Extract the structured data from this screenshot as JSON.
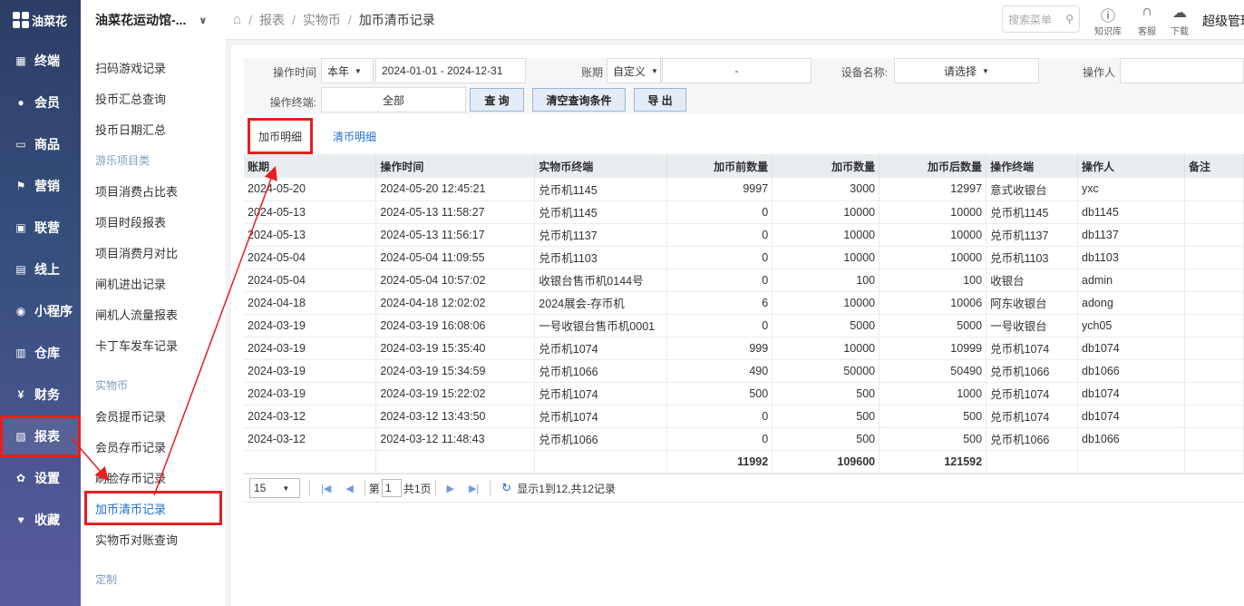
{
  "brand": {
    "name": "油菜花"
  },
  "nav": [
    {
      "label": "终端",
      "icon": "terminal-icon",
      "glyph": "▦"
    },
    {
      "label": "会员",
      "icon": "member-icon",
      "glyph": "●"
    },
    {
      "label": "商品",
      "icon": "goods-icon",
      "glyph": "▭"
    },
    {
      "label": "营销",
      "icon": "flag-icon",
      "glyph": "⚑"
    },
    {
      "label": "联营",
      "icon": "gift-icon",
      "glyph": "▣"
    },
    {
      "label": "线上",
      "icon": "calendar-icon",
      "glyph": "▤"
    },
    {
      "label": "小程序",
      "icon": "mini-program-icon",
      "glyph": "◉"
    },
    {
      "label": "仓库",
      "icon": "warehouse-icon",
      "glyph": "▥"
    },
    {
      "label": "财务",
      "icon": "finance-icon",
      "glyph": "¥"
    },
    {
      "label": "报表",
      "icon": "report-icon",
      "glyph": "▧"
    },
    {
      "label": "设置",
      "icon": "gear-icon",
      "glyph": "✿"
    },
    {
      "label": "收藏",
      "icon": "heart-icon",
      "glyph": "♥"
    }
  ],
  "shop": {
    "name": "油菜花运动馆-..."
  },
  "submenu": {
    "items_top": [
      "扫码游戏记录",
      "投币汇总查询",
      "投币日期汇总"
    ],
    "group1": "游乐项目类",
    "items_mid": [
      "项目消费占比表",
      "项目时段报表",
      "项目消费月对比",
      "闸机进出记录",
      "闸机人流量报表",
      "卡丁车发车记录"
    ],
    "group2": "实物币",
    "items_bottom": [
      "会员提币记录",
      "会员存币记录",
      "刷脸存币记录",
      "加币清币记录",
      "实物币对账查询"
    ],
    "group3": "定制"
  },
  "breadcrumb": [
    "报表",
    "实物币",
    "加币清币记录"
  ],
  "header": {
    "search_placeholder": "搜索菜单",
    "help_label": "知识库",
    "service_label": "客服",
    "download_label": "下载",
    "user": "超级管理"
  },
  "filters": {
    "op_time_label": "操作时间",
    "op_time_mode": "本年",
    "op_time_range": "2024-01-01 - 2024-12-31",
    "period_label": "账期",
    "period_mode": "自定义",
    "period_range": "-",
    "device_label": "设备名称:",
    "device_value": "请选择",
    "operator_label": "操作人",
    "operator_value": "",
    "terminal_label": "操作终端:",
    "terminal_value": "全部",
    "query_btn": "查 询",
    "clear_btn": "清空查询条件",
    "export_btn": "导 出"
  },
  "tabs": [
    "加币明细",
    "清币明细"
  ],
  "table": {
    "headers": [
      "账期",
      "操作时间",
      "实物币终端",
      "加币前数量",
      "加币数量",
      "加币后数量",
      "操作终端",
      "操作人",
      "备注"
    ],
    "rows": [
      [
        "2024-05-20",
        "2024-05-20 12:45:21",
        "兑币机1145",
        "9997",
        "3000",
        "12997",
        "意式收银台",
        "yxc",
        ""
      ],
      [
        "2024-05-13",
        "2024-05-13 11:58:27",
        "兑币机1145",
        "0",
        "10000",
        "10000",
        "兑币机1145",
        "db1145",
        ""
      ],
      [
        "2024-05-13",
        "2024-05-13 11:56:17",
        "兑币机1137",
        "0",
        "10000",
        "10000",
        "兑币机1137",
        "db1137",
        ""
      ],
      [
        "2024-05-04",
        "2024-05-04 11:09:55",
        "兑币机1103",
        "0",
        "10000",
        "10000",
        "兑币机1103",
        "db1103",
        ""
      ],
      [
        "2024-05-04",
        "2024-05-04 10:57:02",
        "收银台售币机0144号",
        "0",
        "100",
        "100",
        "收银台",
        "admin",
        ""
      ],
      [
        "2024-04-18",
        "2024-04-18 12:02:02",
        "2024展会-存币机",
        "6",
        "10000",
        "10006",
        "阿东收银台",
        "adong",
        ""
      ],
      [
        "2024-03-19",
        "2024-03-19 16:08:06",
        "一号收银台售币机0001",
        "0",
        "5000",
        "5000",
        "一号收银台",
        "ych05",
        ""
      ],
      [
        "2024-03-19",
        "2024-03-19 15:35:40",
        "兑币机1074",
        "999",
        "10000",
        "10999",
        "兑币机1074",
        "db1074",
        ""
      ],
      [
        "2024-03-19",
        "2024-03-19 15:34:59",
        "兑币机1066",
        "490",
        "50000",
        "50490",
        "兑币机1066",
        "db1066",
        ""
      ],
      [
        "2024-03-19",
        "2024-03-19 15:22:02",
        "兑币机1074",
        "500",
        "500",
        "1000",
        "兑币机1074",
        "db1074",
        ""
      ],
      [
        "2024-03-12",
        "2024-03-12 13:43:50",
        "兑币机1074",
        "0",
        "500",
        "500",
        "兑币机1074",
        "db1074",
        ""
      ],
      [
        "2024-03-12",
        "2024-03-12 11:48:43",
        "兑币机1066",
        "0",
        "500",
        "500",
        "兑币机1066",
        "db1066",
        ""
      ]
    ],
    "totals": [
      "",
      "",
      "",
      "11992",
      "109600",
      "121592",
      "",
      "",
      ""
    ]
  },
  "pager": {
    "page_size": "15",
    "page_prefix": "第",
    "page_value": "1",
    "page_total": "共1页",
    "summary": "显示1到12,共12记录"
  },
  "colors": {
    "accent": "#1f6fd1",
    "highlight": "#e81e1e",
    "sidebar": "#2c3e66"
  }
}
